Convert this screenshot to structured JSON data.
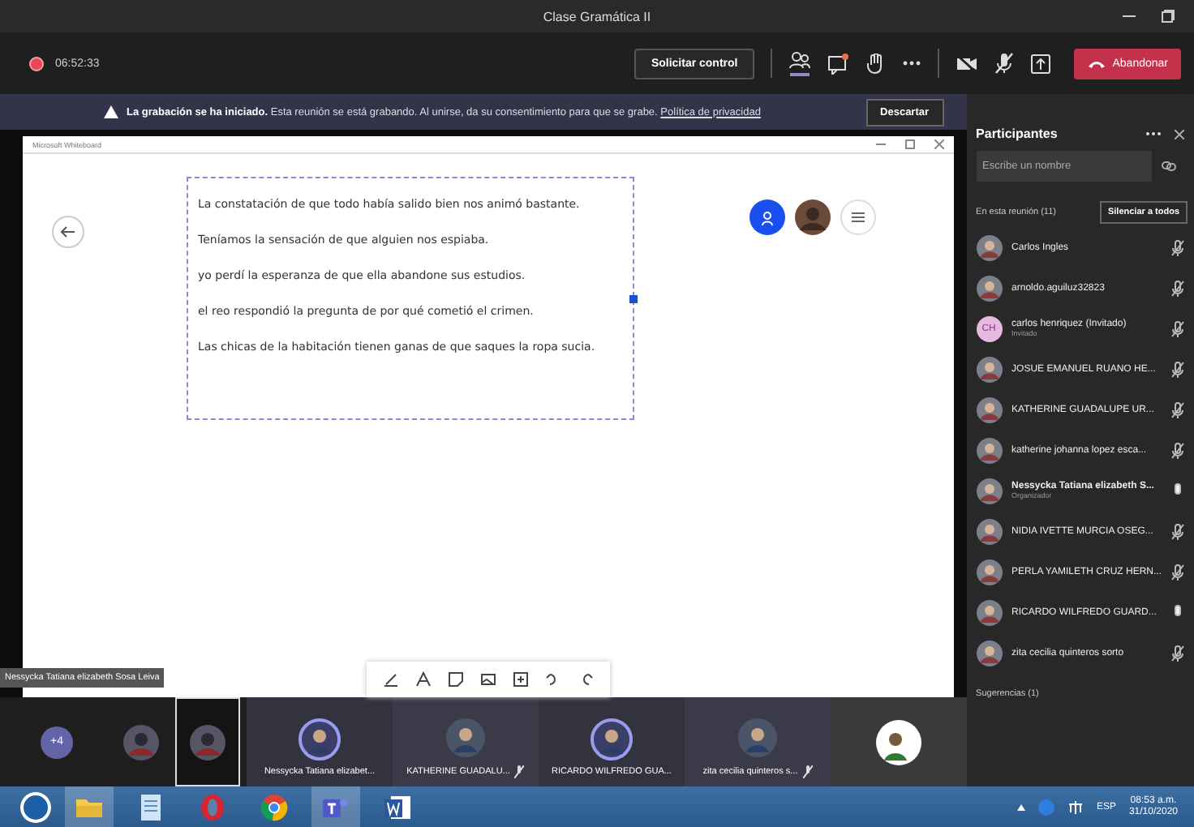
{
  "window": {
    "title": "Clase Gramática II"
  },
  "meeting_bar": {
    "timer": "06:52:33",
    "request_control": "Solicitar control",
    "leave": "Abandonar"
  },
  "banner": {
    "text": "**La grabación se ha iniciado.** Esta reunión se está grabando. Al unirse, da su consentimiento para que se grabe.",
    "link": "Política de privacidad",
    "dismiss": "Descartar"
  },
  "whiteboard": {
    "title": "Microsoft Whiteboard",
    "sentences": [
      "La constatación de que todo había salido bien nos animó bastante.",
      "Teníamos la sensación de que alguien nos espiaba.",
      "yo perdí la esperanza de que ella abandone sus estudios.",
      "el reo respondió la pregunta de por qué cometió el crimen.",
      " Las chicas de la habitación tienen ganas de que saques la ropa sucia."
    ]
  },
  "presenter_tag": "Nessycka Tatiana elizabeth Sosa Leiva",
  "video_strip": [
    {
      "kind": "count",
      "label": "+4"
    },
    {
      "kind": "thumb",
      "selected": false
    },
    {
      "kind": "thumb",
      "selected": true
    },
    {
      "kind": "person",
      "name": "Nessycka Tatiana elizabet...",
      "speaking": true,
      "muted": false
    },
    {
      "kind": "person",
      "name": "KATHERINE GUADALU...",
      "speaking": false,
      "muted": true
    },
    {
      "kind": "person",
      "name": "RICARDO WILFREDO GUA...",
      "speaking": true,
      "muted": false
    },
    {
      "kind": "person",
      "name": "zita cecilia quinteros s...",
      "speaking": false,
      "muted": true
    },
    {
      "kind": "self"
    }
  ],
  "participants_panel": {
    "title": "Participantes",
    "search": {
      "placeholder": "Escribe un nombre"
    },
    "section": "En esta reunión (11)",
    "mute_all": "Silenciar a todos",
    "suggestions": "Sugerencias (1)",
    "people": [
      {
        "name": "Carlos Ingles",
        "muted": true
      },
      {
        "name": "arnoldo.aguiluz32823",
        "muted": true
      },
      {
        "name": "carlos henriquez (Invitado)",
        "initials": "CH",
        "subtitle": "Invitado",
        "muted": true
      },
      {
        "name": "JOSUE EMANUEL RUANO HE...",
        "muted": true
      },
      {
        "name": "KATHERINE GUADALUPE UR...",
        "muted": true
      },
      {
        "name": "katherine johanna lopez esca...",
        "muted": true
      },
      {
        "name": "Nessycka Tatiana elizabeth S...",
        "subtitle": "Organizador",
        "muted": false
      },
      {
        "name": "NIDIA IVETTE MURCIA OSEG...",
        "muted": true
      },
      {
        "name": "PERLA YAMILETH CRUZ HERN...",
        "muted": true
      },
      {
        "name": "RICARDO WILFREDO GUARD...",
        "muted": false
      },
      {
        "name": "zita cecilia quinteros sorto",
        "muted": true
      }
    ]
  },
  "taskbar": {
    "language": "ESP",
    "time": "08:53 a.m.",
    "date": "31/10/2020"
  }
}
